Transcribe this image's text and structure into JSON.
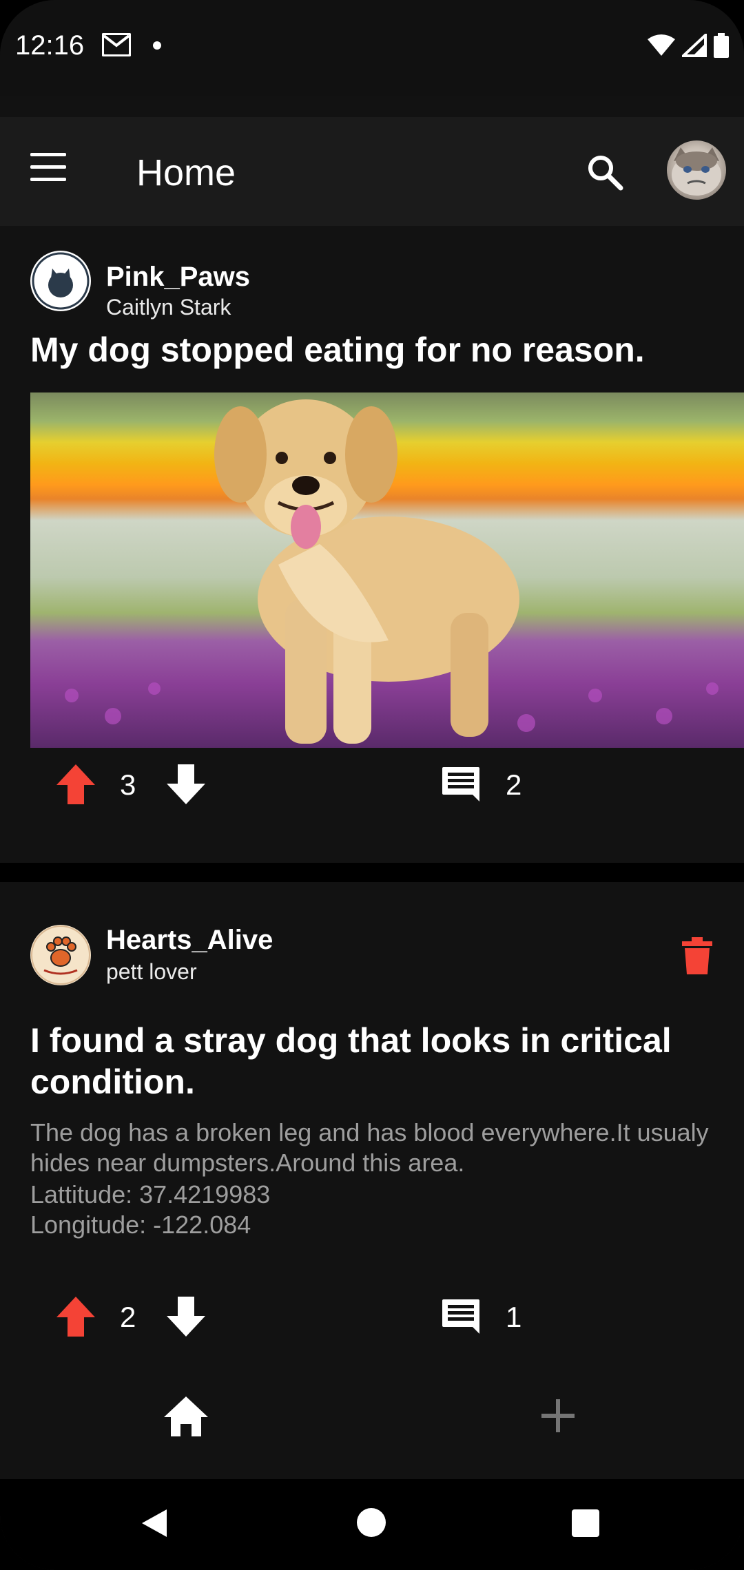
{
  "status_bar": {
    "time": "12:16",
    "icons": [
      "gmail-icon",
      "notification-dot-icon",
      "wifi-icon",
      "signal-icon",
      "battery-icon"
    ]
  },
  "app_bar": {
    "title": "Home",
    "menu_icon": "menu-icon",
    "search_icon": "search-icon"
  },
  "posts": [
    {
      "username": "Pink_Paws",
      "display_name": "Caitlyn Stark",
      "title": "My dog stopped eating for no reason.",
      "upvotes": "3",
      "comments": "2"
    },
    {
      "username": "Hearts_Alive",
      "display_name": "pett lover",
      "title": "I found a stray dog that looks in critical condition.",
      "body": "The dog has a broken leg and has blood everywhere.It usualy hides near dumpsters.Around this area.",
      "latitude": "Lattitude: 37.4219983",
      "longitude": "Longitude: -122.084",
      "upvotes": "2",
      "comments": "1"
    }
  ],
  "bottom_nav": {
    "items": [
      "home-icon",
      "add-icon"
    ]
  },
  "colors": {
    "background": "#121212",
    "app_bar": "#1b1b1b",
    "accent_red": "#f44336",
    "secondary_text": "#9e9e9e"
  }
}
